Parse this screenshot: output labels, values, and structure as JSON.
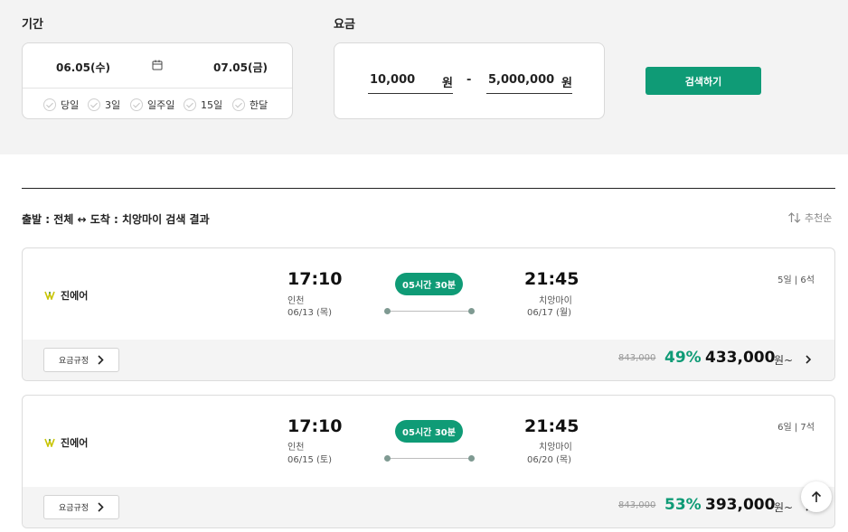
{
  "filters": {
    "period_label": "기간",
    "start_date": "06.05(수)",
    "end_date": "07.05(금)",
    "quick_options": [
      "당일",
      "3일",
      "일주일",
      "15일",
      "한달"
    ],
    "fare_label": "요금",
    "price_min": "10,000",
    "price_max": "5,000,000",
    "currency_unit": "원",
    "price_separator": "-",
    "search_button": "검색하기"
  },
  "results": {
    "title": "출발 : 전체 ↔ 도착 : 치앙마이 검색 결과",
    "sort_label": "추천순"
  },
  "flights": [
    {
      "airline": "진에어",
      "depart_time": "17:10",
      "depart_city": "인천",
      "depart_date": "06/13 (목)",
      "duration": "05시간 30분",
      "arrive_time": "21:45",
      "arrive_city": "치앙마이",
      "arrive_date": "06/17 (월)",
      "stay_seats": "5일 | 6석",
      "rule_button": "요금규정",
      "original_price": "843,000",
      "discount": "49%",
      "price": "433,000",
      "price_suffix": "원~"
    },
    {
      "airline": "진에어",
      "depart_time": "17:10",
      "depart_city": "인천",
      "depart_date": "06/15 (토)",
      "duration": "05시간 30분",
      "arrive_time": "21:45",
      "arrive_city": "치앙마이",
      "arrive_date": "06/20 (목)",
      "stay_seats": "6일 | 7석",
      "rule_button": "요금규정",
      "original_price": "843,000",
      "discount": "53%",
      "price": "393,000",
      "price_suffix": "원~"
    }
  ],
  "icons": {
    "calendar": "calendar-icon",
    "check": "check-circle-icon",
    "sort": "sort-arrows-icon",
    "chevron": "chevron-right-icon",
    "scroll_top": "arrow-up-icon",
    "airline_logo": "jinair-logo-icon"
  },
  "colors": {
    "accent": "#0f9b76",
    "filter_background": "#f3f3f3",
    "strikethrough_price": "#999999"
  }
}
